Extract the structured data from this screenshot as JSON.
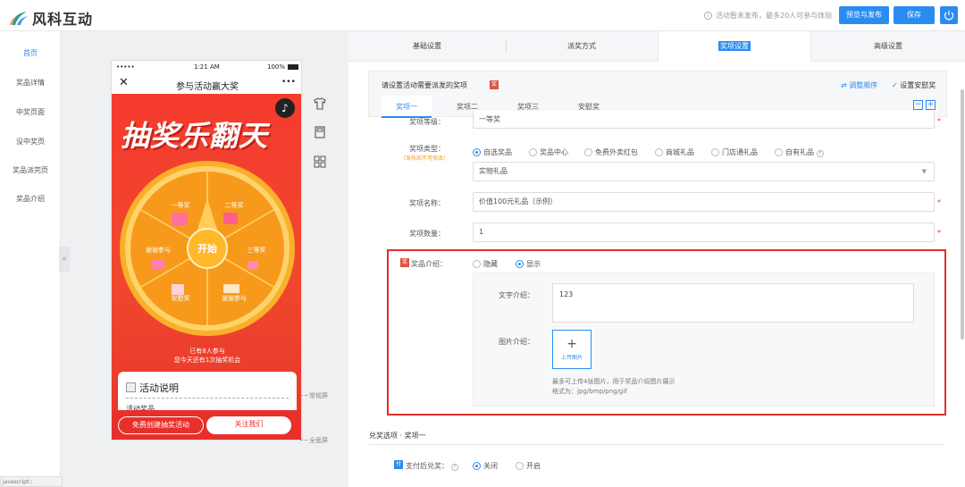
{
  "header": {
    "brand": "风科互动",
    "notice": "活动暂未发布，最多20人可参与体验",
    "preview_btn": "预览与发布",
    "save_btn": "保存"
  },
  "nav": [
    "首页",
    "奖品详情",
    "中奖页面",
    "没中奖页",
    "奖品派完页",
    "奖品介绍"
  ],
  "phone": {
    "signal": "•••••",
    "time": "1:21 AM",
    "battery": "100%",
    "title": "参与活动赢大奖",
    "more": "•••",
    "hero_title": "抽奖乐翻天",
    "start": "开始",
    "prizes": [
      "一等奖",
      "二等奖",
      "三等奖",
      "谢谢参与",
      "安慰奖",
      "谢谢参与"
    ],
    "join_line1": "已有8人参与",
    "join_line2": "您今天还有1次抽奖机会",
    "card_title": "活动说明",
    "card_sub": "活动奖品",
    "btn_create": "免费创建抽奖活动",
    "btn_follow": "关注我们"
  },
  "side": {
    "label_normal": "常规屏",
    "label_full": "全面屏"
  },
  "tabs": [
    "基础设置",
    "派奖方式",
    "奖项设置",
    "高级设置"
  ],
  "panel": {
    "title": "请设置活动需要派发的奖项",
    "sort": "调整顺序",
    "consolation": "设置安慰奖",
    "subtabs": [
      "奖项一",
      "奖项二",
      "奖项三",
      "安慰奖"
    ]
  },
  "form": {
    "level_label": "奖项等级：",
    "level_value": "一等奖",
    "type_label": "奖项类型：",
    "type_note": "（发布后不可修改）",
    "type_opts": [
      "自选奖品",
      "奖品中心",
      "免费外卖红包",
      "商城礼品",
      "门店通礼品",
      "自有礼品"
    ],
    "type_select": "实物礼品",
    "name_label": "奖项名称：",
    "name_value": "价值100元礼品（示例）",
    "qty_label": "奖项数量：",
    "qty_value": "1",
    "intro_label": "奖品介绍：",
    "hide": "隐藏",
    "show": "显示",
    "text_intro_label": "文字介绍：",
    "text_intro_value": "123",
    "img_intro_label": "图片介绍：",
    "upload": "上传图片",
    "hint1": "最多可上传4张图片，用于奖品介绍图片展示",
    "hint2": "格式为：jpg/bmp/png/gif",
    "redeem_title": "兑奖选项 · 奖项一",
    "pay_label": "支付后兑奖：",
    "off": "关闭",
    "on": "开启"
  },
  "status_bar": "javascript:;",
  "colors": {
    "accent": "#2b8cf0",
    "highlight": "#e02d2d",
    "hero": "#f53b2e"
  }
}
